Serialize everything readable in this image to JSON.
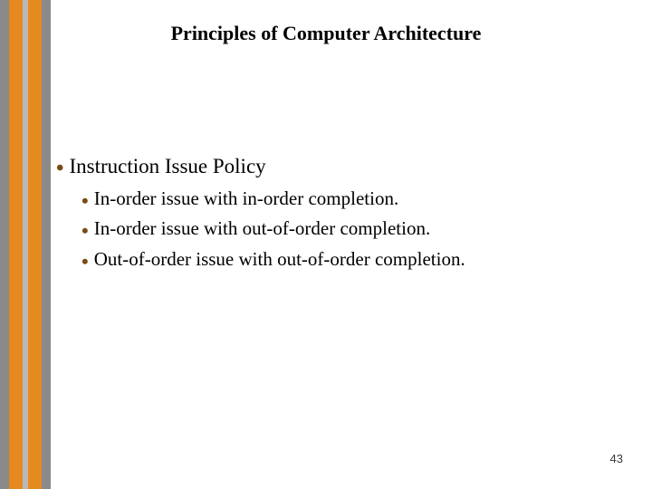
{
  "title": "Principles of Computer Architecture",
  "content": {
    "level1": "Instruction Issue Policy",
    "level2": [
      "In-order issue with in-order completion.",
      "In-order issue with out-of-order completion.",
      "Out-of-order issue with out-of-order completion."
    ]
  },
  "page_number": "43",
  "bullet_glyph": "•"
}
